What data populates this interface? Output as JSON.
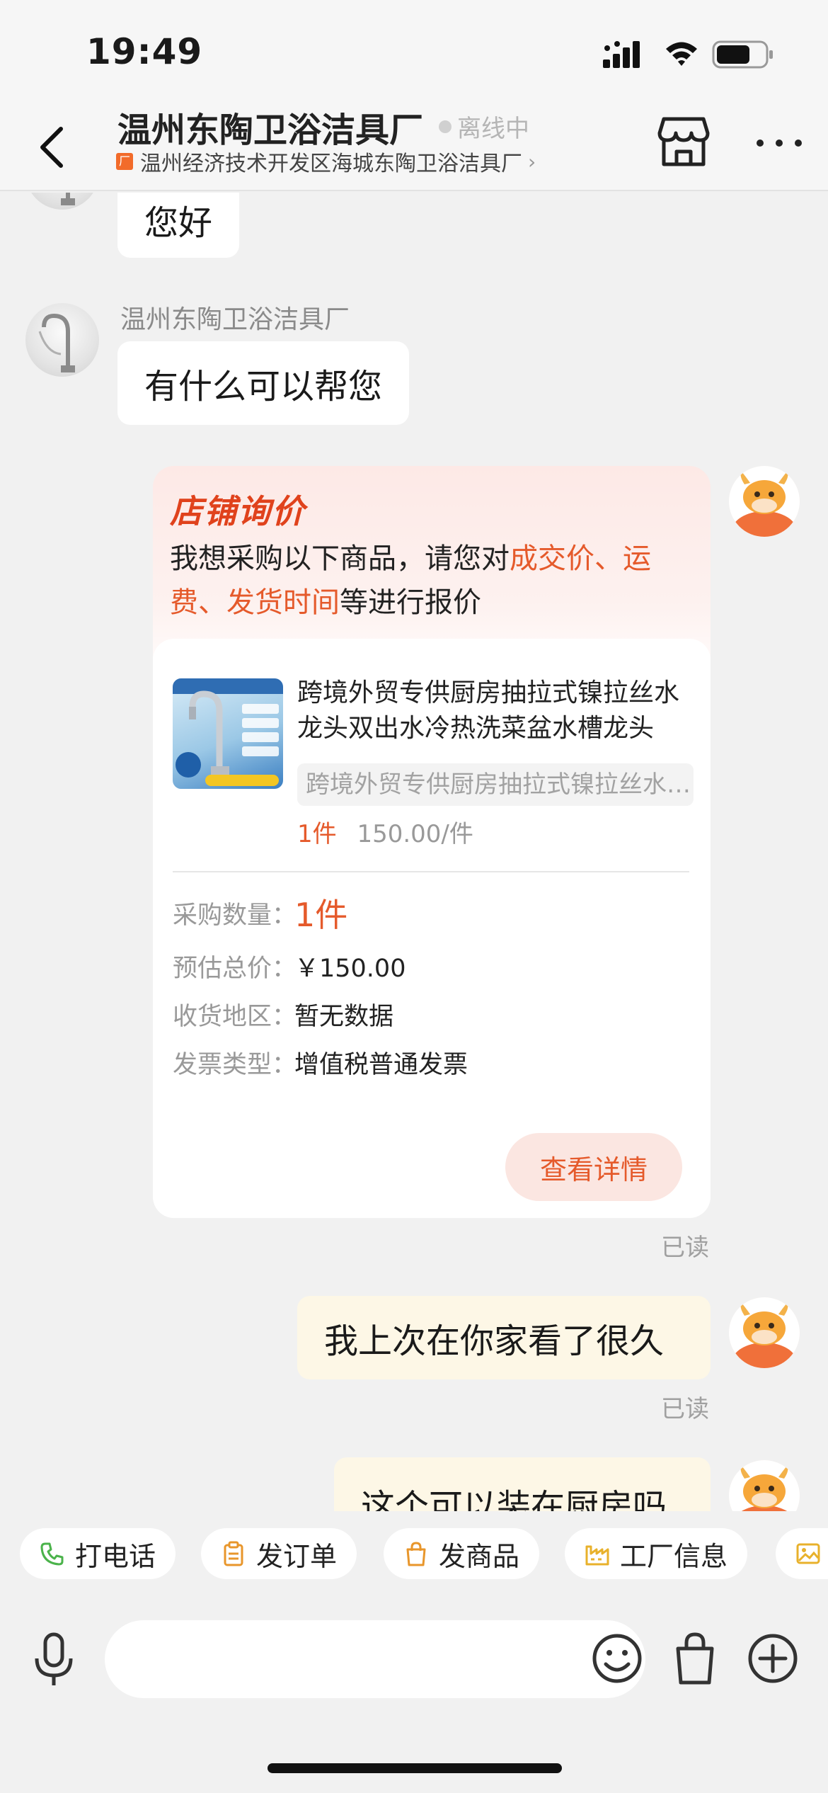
{
  "status_bar": {
    "time": "19:49"
  },
  "header": {
    "shop_name": "温州东陶卫浴洁具厂",
    "status": "离线中",
    "company_name": "温州经济技术开发区海城东陶卫浴洁具厂",
    "company_chevron": "›",
    "factory_tag": "厂"
  },
  "messages": {
    "greeting": "您好",
    "seller_name": "温州东陶卫浴洁具厂",
    "seller_reply": "有什么可以帮您",
    "inquiry_card": {
      "title": "店铺询价",
      "intro_prefix": "我想采购以下商品，请您对",
      "intro_highlight": "成交价、运费、发货时间",
      "intro_suffix": "等进行报价",
      "product_title": "跨境外贸专供厨房抽拉式镍拉丝水龙头双出水冷热洗菜盆水槽龙头",
      "product_sku": "跨境外贸专供厨房抽拉式镍拉丝水龙头双出水冷热洗菜盆水槽龙头",
      "product_qty": "1件",
      "product_unit_price": "150.00/件",
      "fields": {
        "quantity_label": "采购数量：",
        "quantity_value": "1件",
        "total_label": "预估总价：",
        "total_value": "￥150.00",
        "region_label": "收货地区：",
        "region_value": "暂无数据",
        "invoice_label": "发票类型：",
        "invoice_value": "增值税普通发票"
      },
      "detail_button": "查看详情"
    },
    "read_label_1": "已读",
    "buyer_msg_1": "我上次在你家看了很久",
    "read_label_2": "已读",
    "buyer_msg_2": "这个可以装在厨房吗"
  },
  "quick_actions": [
    {
      "label": "打电话",
      "icon": "phone-icon"
    },
    {
      "label": "发订单",
      "icon": "clipboard-icon"
    },
    {
      "label": "发商品",
      "icon": "shopping-bag-icon"
    },
    {
      "label": "工厂信息",
      "icon": "factory-icon"
    },
    {
      "label": "",
      "icon": "image-icon"
    }
  ],
  "input_bar": {
    "placeholder": ""
  },
  "colors": {
    "accent": "#e55a2b",
    "title_red": "#e0421c",
    "buyer_bubble": "#fdf7e6",
    "background": "#f1f1f1"
  }
}
